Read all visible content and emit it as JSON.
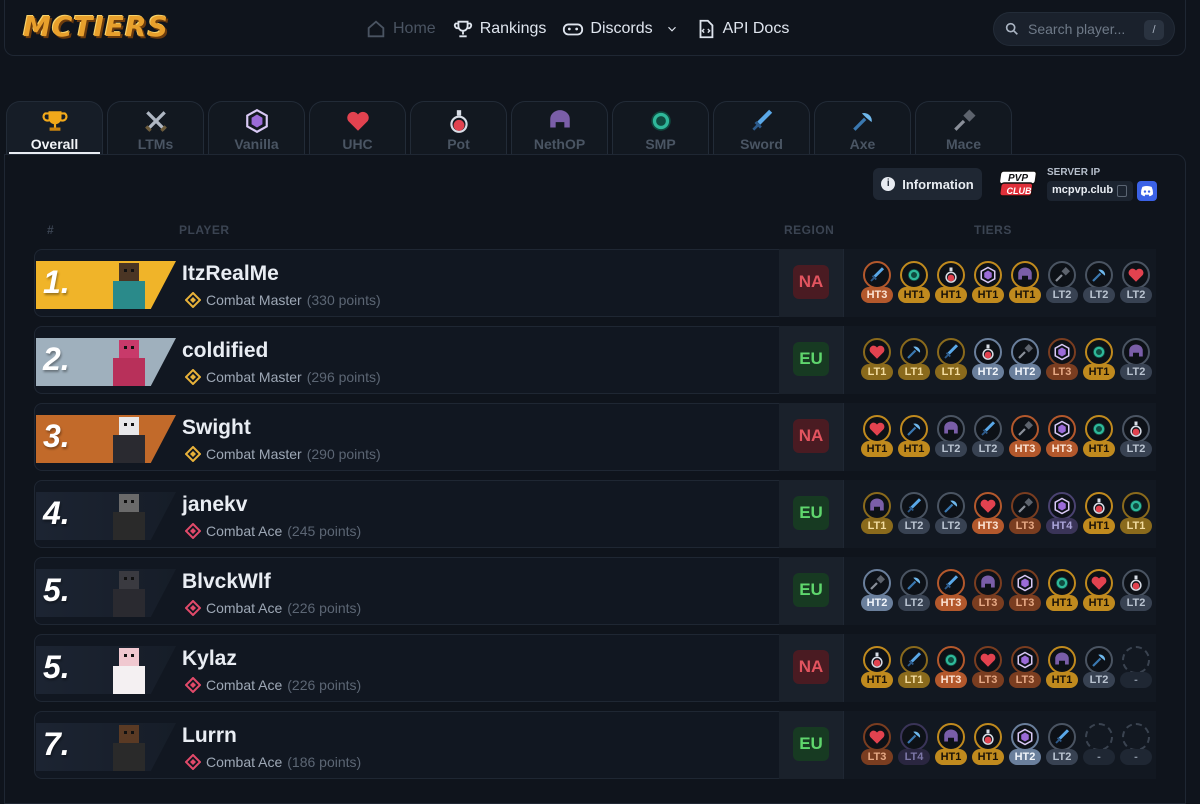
{
  "brand": {
    "logo_text": "MCTIERS"
  },
  "nav": [
    {
      "label": "Home",
      "icon": "home-icon",
      "active": false
    },
    {
      "label": "Rankings",
      "icon": "trophy-icon",
      "active": true
    },
    {
      "label": "Discords",
      "icon": "controller-icon",
      "active": true
    },
    {
      "label": "API Docs",
      "icon": "document-icon",
      "active": true
    }
  ],
  "search": {
    "placeholder": "Search player...",
    "shortcut": "/"
  },
  "tabs": [
    {
      "label": "Overall",
      "icon": "trophy-icon",
      "active": true
    },
    {
      "label": "LTMs",
      "icon": "crossed-swords-icon"
    },
    {
      "label": "Vanilla",
      "icon": "crystal-icon"
    },
    {
      "label": "UHC",
      "icon": "heart-icon"
    },
    {
      "label": "Pot",
      "icon": "potion-icon"
    },
    {
      "label": "NethOP",
      "icon": "netherite-helmet-icon"
    },
    {
      "label": "SMP",
      "icon": "ender-pearl-icon"
    },
    {
      "label": "Sword",
      "icon": "sword-icon"
    },
    {
      "label": "Axe",
      "icon": "axe-icon"
    },
    {
      "label": "Mace",
      "icon": "mace-icon"
    }
  ],
  "info_button": "Information",
  "server": {
    "label": "SERVER IP",
    "ip": "mcpvp.club",
    "logo_text": "PVP CLUB"
  },
  "table_headers": {
    "rank": "#",
    "player": "PLAYER",
    "region": "REGION",
    "tiers": "TIERS"
  },
  "colors": {
    "gold": "#f0b429",
    "silver": "#9fb0bd",
    "bronze": "#c26a2a",
    "dark": "#1c2432"
  },
  "players": [
    {
      "rank": "1.",
      "rank_style": "gold",
      "name": "ItzRealMe",
      "title": "Combat Master",
      "points": "(330 points)",
      "region": "NA",
      "tiers": [
        {
          "icon": "sword",
          "tier": "HT3"
        },
        {
          "icon": "pearl",
          "tier": "HT1"
        },
        {
          "icon": "potion",
          "tier": "HT1"
        },
        {
          "icon": "crystal",
          "tier": "HT1"
        },
        {
          "icon": "helmet",
          "tier": "HT1"
        },
        {
          "icon": "mace",
          "tier": "LT2"
        },
        {
          "icon": "axe",
          "tier": "LT2"
        },
        {
          "icon": "heart",
          "tier": "LT2"
        }
      ]
    },
    {
      "rank": "2.",
      "rank_style": "silver",
      "name": "coldified",
      "title": "Combat Master",
      "points": "(296 points)",
      "region": "EU",
      "tiers": [
        {
          "icon": "heart",
          "tier": "LT1"
        },
        {
          "icon": "axe",
          "tier": "LT1"
        },
        {
          "icon": "sword",
          "tier": "LT1"
        },
        {
          "icon": "potion",
          "tier": "HT2"
        },
        {
          "icon": "mace",
          "tier": "HT2"
        },
        {
          "icon": "crystal",
          "tier": "LT3"
        },
        {
          "icon": "pearl",
          "tier": "HT1"
        },
        {
          "icon": "helmet",
          "tier": "LT2"
        }
      ]
    },
    {
      "rank": "3.",
      "rank_style": "bronze",
      "name": "Swight",
      "title": "Combat Master",
      "points": "(290 points)",
      "region": "NA",
      "tiers": [
        {
          "icon": "heart",
          "tier": "HT1"
        },
        {
          "icon": "axe",
          "tier": "HT1"
        },
        {
          "icon": "helmet",
          "tier": "LT2"
        },
        {
          "icon": "sword",
          "tier": "LT2"
        },
        {
          "icon": "mace",
          "tier": "HT3"
        },
        {
          "icon": "crystal",
          "tier": "HT3"
        },
        {
          "icon": "pearl",
          "tier": "HT1"
        },
        {
          "icon": "potion",
          "tier": "LT2"
        }
      ]
    },
    {
      "rank": "4.",
      "rank_style": "dark",
      "name": "janekv",
      "title": "Combat Ace",
      "points": "(245 points)",
      "region": "EU",
      "tiers": [
        {
          "icon": "helmet",
          "tier": "LT1"
        },
        {
          "icon": "sword",
          "tier": "LT2"
        },
        {
          "icon": "axe",
          "tier": "LT2"
        },
        {
          "icon": "heart",
          "tier": "HT3"
        },
        {
          "icon": "mace",
          "tier": "LT3"
        },
        {
          "icon": "crystal",
          "tier": "HT4"
        },
        {
          "icon": "potion",
          "tier": "HT1"
        },
        {
          "icon": "pearl",
          "tier": "LT1"
        }
      ]
    },
    {
      "rank": "5.",
      "rank_style": "dark",
      "name": "BlvckWlf",
      "title": "Combat Ace",
      "points": "(226 points)",
      "region": "EU",
      "tiers": [
        {
          "icon": "mace",
          "tier": "HT2"
        },
        {
          "icon": "axe",
          "tier": "LT2"
        },
        {
          "icon": "sword",
          "tier": "HT3"
        },
        {
          "icon": "helmet",
          "tier": "LT3"
        },
        {
          "icon": "crystal",
          "tier": "LT3"
        },
        {
          "icon": "pearl",
          "tier": "HT1"
        },
        {
          "icon": "heart",
          "tier": "HT1"
        },
        {
          "icon": "potion",
          "tier": "LT2"
        }
      ]
    },
    {
      "rank": "5.",
      "rank_style": "dark",
      "name": "Kylaz",
      "title": "Combat Ace",
      "points": "(226 points)",
      "region": "NA",
      "tiers": [
        {
          "icon": "potion",
          "tier": "HT1"
        },
        {
          "icon": "sword",
          "tier": "LT1"
        },
        {
          "icon": "pearl",
          "tier": "HT3"
        },
        {
          "icon": "heart",
          "tier": "LT3"
        },
        {
          "icon": "crystal",
          "tier": "LT3"
        },
        {
          "icon": "helmet",
          "tier": "HT1"
        },
        {
          "icon": "axe",
          "tier": "LT2"
        },
        {
          "icon": "empty",
          "tier": "-"
        }
      ]
    },
    {
      "rank": "7.",
      "rank_style": "dark",
      "name": "Lurrn",
      "title": "Combat Ace",
      "points": "(186 points)",
      "region": "EU",
      "tiers": [
        {
          "icon": "heart",
          "tier": "LT3"
        },
        {
          "icon": "axe",
          "tier": "LT4"
        },
        {
          "icon": "helmet",
          "tier": "HT1"
        },
        {
          "icon": "potion",
          "tier": "HT1"
        },
        {
          "icon": "crystal",
          "tier": "HT2"
        },
        {
          "icon": "sword",
          "tier": "LT2"
        },
        {
          "icon": "empty",
          "tier": "-"
        },
        {
          "icon": "empty",
          "tier": "-"
        }
      ]
    }
  ]
}
